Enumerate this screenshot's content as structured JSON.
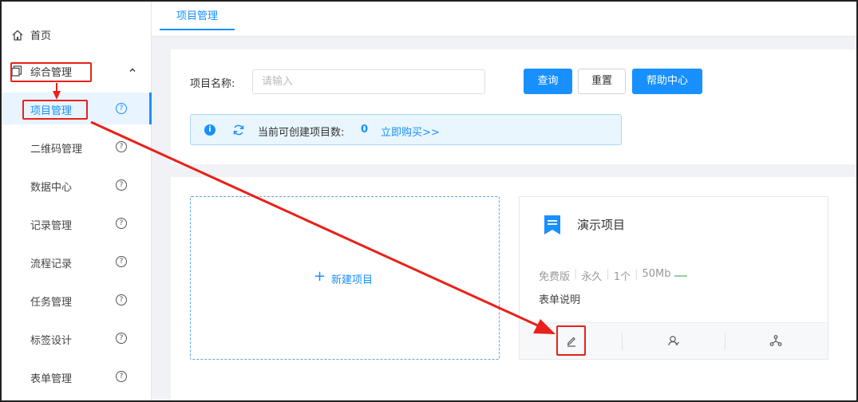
{
  "sidebar": {
    "home": {
      "label": "首页",
      "icon": "home-icon"
    },
    "group": {
      "label": "综合管理",
      "icon": "copy-icon",
      "expanded": true
    },
    "items": [
      {
        "label": "项目管理",
        "active": true
      },
      {
        "label": "二维码管理",
        "active": false
      },
      {
        "label": "数据中心",
        "active": false
      },
      {
        "label": "记录管理",
        "active": false
      },
      {
        "label": "流程记录",
        "active": false
      },
      {
        "label": "任务管理",
        "active": false
      },
      {
        "label": "标签设计",
        "active": false
      },
      {
        "label": "表单管理",
        "active": false
      }
    ],
    "help_glyph": "?"
  },
  "tabs": [
    {
      "label": "项目管理",
      "active": true
    }
  ],
  "search": {
    "label": "项目名称:",
    "placeholder": "请输入",
    "value": "",
    "query_button": "查询",
    "reset_button": "重置",
    "help_button": "帮助中心"
  },
  "notice": {
    "text": "当前可创建项目数:",
    "count": "0",
    "buy_link": "立即购买>>"
  },
  "new_project": {
    "plus": "+",
    "label": "新建项目"
  },
  "project_card": {
    "title": "演示项目",
    "edition": "免费版",
    "duration": "永久",
    "quantity": "1个",
    "storage": "50Mb",
    "description": "表单说明"
  },
  "colors": {
    "primary": "#1890ff",
    "annotation": "#e8211a",
    "notice_bg": "#e9f6fd"
  }
}
